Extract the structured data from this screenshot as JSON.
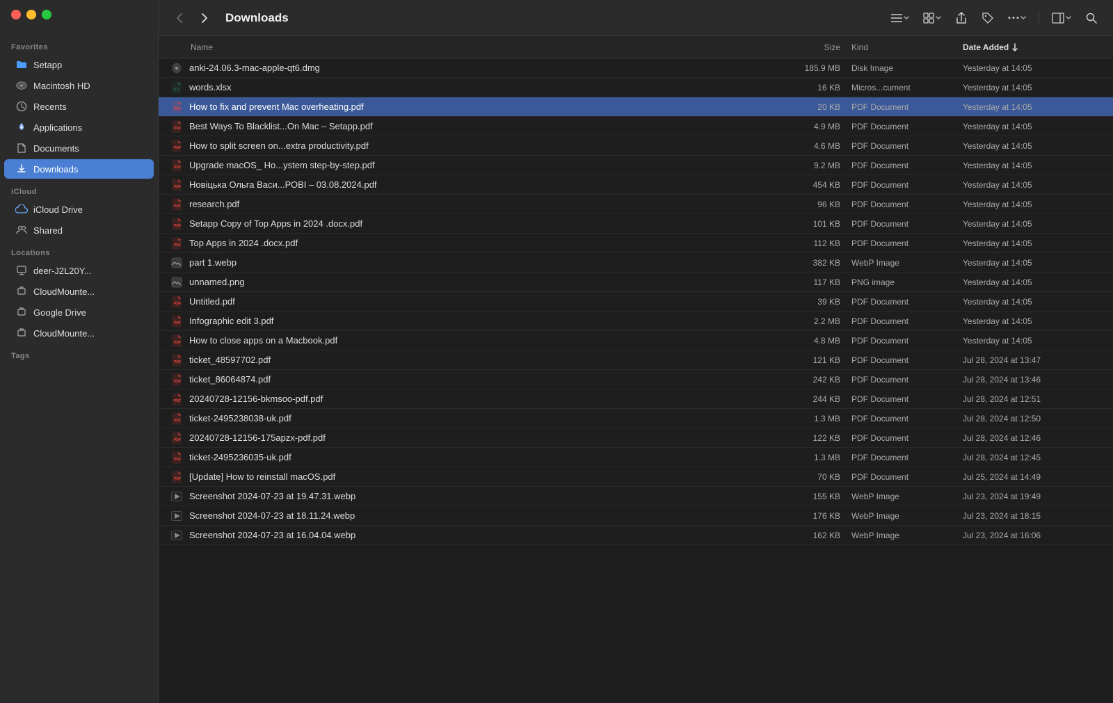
{
  "window": {
    "title": "Downloads"
  },
  "traffic_lights": {
    "red_label": "close",
    "yellow_label": "minimize",
    "green_label": "maximize"
  },
  "toolbar": {
    "back_label": "‹",
    "forward_label": "›",
    "title": "Downloads",
    "list_view_label": "≡",
    "grid_view_label": "⊞",
    "share_label": "↑",
    "tag_label": "⬡",
    "more_label": "···",
    "preview_label": "⬚",
    "search_label": "⌕"
  },
  "columns": {
    "name": "Name",
    "size": "Size",
    "kind": "Kind",
    "date_added": "Date Added"
  },
  "sidebar": {
    "favorites_label": "Favorites",
    "icloud_label": "iCloud",
    "locations_label": "Locations",
    "tags_label": "Tags",
    "items": [
      {
        "id": "setapp",
        "label": "Setapp",
        "icon": "folder-blue"
      },
      {
        "id": "macintosh-hd",
        "label": "Macintosh HD",
        "icon": "drive"
      },
      {
        "id": "recents",
        "label": "Recents",
        "icon": "clock"
      },
      {
        "id": "applications",
        "label": "Applications",
        "icon": "rocket"
      },
      {
        "id": "documents",
        "label": "Documents",
        "icon": "doc"
      },
      {
        "id": "downloads",
        "label": "Downloads",
        "icon": "arrow-down",
        "active": true
      },
      {
        "id": "icloud-drive",
        "label": "iCloud Drive",
        "icon": "cloud"
      },
      {
        "id": "shared",
        "label": "Shared",
        "icon": "person-2"
      },
      {
        "id": "deer-j2l20y",
        "label": "deer-J2L20Y...",
        "icon": "monitor"
      },
      {
        "id": "cloudmount-1",
        "label": "CloudMounte...",
        "icon": "drive-ext"
      },
      {
        "id": "google-drive",
        "label": "Google Drive",
        "icon": "drive-ext"
      },
      {
        "id": "cloudmount-2",
        "label": "CloudMounte...",
        "icon": "drive-ext"
      }
    ]
  },
  "files": [
    {
      "name": "anki-24.06.3-mac-apple-qt6.dmg",
      "size": "185.9 MB",
      "kind": "Disk Image",
      "date": "Yesterday at 14:05",
      "type": "dmg"
    },
    {
      "name": "words.xlsx",
      "size": "16 KB",
      "kind": "Micros...cument",
      "date": "Yesterday at 14:05",
      "type": "xlsx"
    },
    {
      "name": "How to fix and prevent Mac overheating.pdf",
      "size": "20 KB",
      "kind": "PDF Document",
      "date": "Yesterday at 14:05",
      "type": "pdf",
      "selected": true
    },
    {
      "name": "Best Ways To Blacklist...On Mac – Setapp.pdf",
      "size": "4.9 MB",
      "kind": "PDF Document",
      "date": "Yesterday at 14:05",
      "type": "pdf"
    },
    {
      "name": "How to split screen on...extra productivity.pdf",
      "size": "4.6 MB",
      "kind": "PDF Document",
      "date": "Yesterday at 14:05",
      "type": "pdf"
    },
    {
      "name": "Upgrade macOS_ Ho...ystem step-by-step.pdf",
      "size": "9.2 MB",
      "kind": "PDF Document",
      "date": "Yesterday at 14:05",
      "type": "pdf"
    },
    {
      "name": "Новіцька Ольга Васи...РОBI – 03.08.2024.pdf",
      "size": "454 KB",
      "kind": "PDF Document",
      "date": "Yesterday at 14:05",
      "type": "pdf"
    },
    {
      "name": "research.pdf",
      "size": "96 KB",
      "kind": "PDF Document",
      "date": "Yesterday at 14:05",
      "type": "pdf"
    },
    {
      "name": "Setapp Copy of Top Apps in 2024 .docx.pdf",
      "size": "101 KB",
      "kind": "PDF Document",
      "date": "Yesterday at 14:05",
      "type": "pdf"
    },
    {
      "name": "Top Apps in 2024 .docx.pdf",
      "size": "112 KB",
      "kind": "PDF Document",
      "date": "Yesterday at 14:05",
      "type": "pdf"
    },
    {
      "name": "part 1.webp",
      "size": "382 KB",
      "kind": "WebP Image",
      "date": "Yesterday at 14:05",
      "type": "webp"
    },
    {
      "name": "unnamed.png",
      "size": "117 KB",
      "kind": "PNG image",
      "date": "Yesterday at 14:05",
      "type": "png"
    },
    {
      "name": "Untitled.pdf",
      "size": "39 KB",
      "kind": "PDF Document",
      "date": "Yesterday at 14:05",
      "type": "pdf"
    },
    {
      "name": "Infographic edit 3.pdf",
      "size": "2.2 MB",
      "kind": "PDF Document",
      "date": "Yesterday at 14:05",
      "type": "pdf"
    },
    {
      "name": "How to close apps on a Macbook.pdf",
      "size": "4.8 MB",
      "kind": "PDF Document",
      "date": "Yesterday at 14:05",
      "type": "pdf"
    },
    {
      "name": "ticket_48597702.pdf",
      "size": "121 KB",
      "kind": "PDF Document",
      "date": "Jul 28, 2024 at 13:47",
      "type": "pdf"
    },
    {
      "name": "ticket_86064874.pdf",
      "size": "242 KB",
      "kind": "PDF Document",
      "date": "Jul 28, 2024 at 13:46",
      "type": "pdf"
    },
    {
      "name": "20240728-12156-bkmsoo-pdf.pdf",
      "size": "244 KB",
      "kind": "PDF Document",
      "date": "Jul 28, 2024 at 12:51",
      "type": "pdf"
    },
    {
      "name": "ticket-2495238038-uk.pdf",
      "size": "1.3 MB",
      "kind": "PDF Document",
      "date": "Jul 28, 2024 at 12:50",
      "type": "pdf"
    },
    {
      "name": "20240728-12156-175apzx-pdf.pdf",
      "size": "122 KB",
      "kind": "PDF Document",
      "date": "Jul 28, 2024 at 12:46",
      "type": "pdf"
    },
    {
      "name": "ticket-2495236035-uk.pdf",
      "size": "1.3 MB",
      "kind": "PDF Document",
      "date": "Jul 28, 2024 at 12:45",
      "type": "pdf"
    },
    {
      "name": "[Update] How to reinstall macOS.pdf",
      "size": "70 KB",
      "kind": "PDF Document",
      "date": "Jul 25, 2024 at 14:49",
      "type": "pdf"
    },
    {
      "name": "Screenshot 2024-07-23 at 19.47.31.webp",
      "size": "155 KB",
      "kind": "WebP Image",
      "date": "Jul 23, 2024 at 19:49",
      "type": "webm"
    },
    {
      "name": "Screenshot 2024-07-23 at 18.11.24.webp",
      "size": "176 KB",
      "kind": "WebP Image",
      "date": "Jul 23, 2024 at 18:15",
      "type": "webm"
    },
    {
      "name": "Screenshot 2024-07-23 at 16.04.04.webp",
      "size": "162 KB",
      "kind": "WebP Image",
      "date": "Jul 23, 2024 at 16:06",
      "type": "webm"
    }
  ],
  "icons": {
    "pdf": "📄",
    "dmg": "💿",
    "xlsx": "📊",
    "webp": "🖼",
    "png": "🖼",
    "docx": "📝",
    "webm": "🎬"
  }
}
